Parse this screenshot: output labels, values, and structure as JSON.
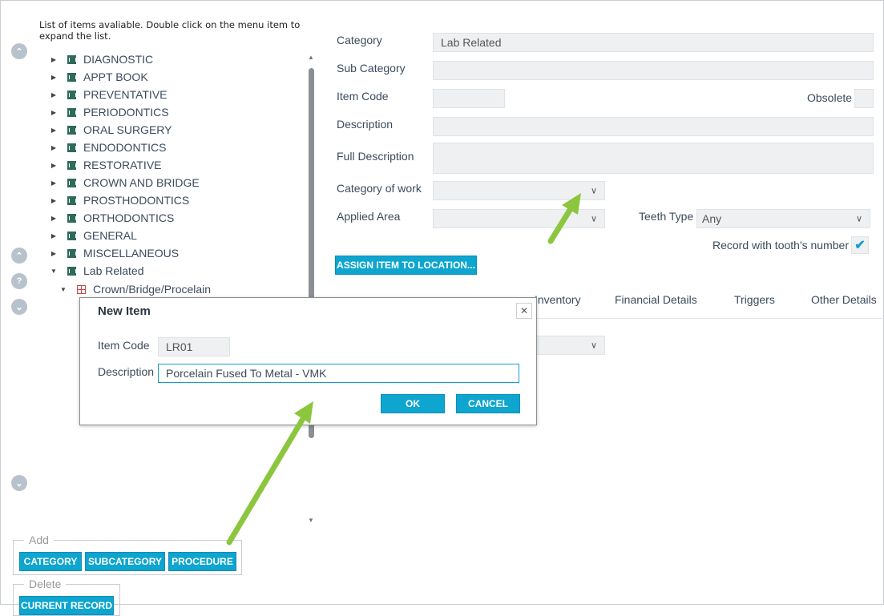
{
  "hint": "List of items avaliable. Double click on the menu item to expand the list.",
  "tree": {
    "categories": [
      "DIAGNOSTIC",
      "APPT BOOK",
      "PREVENTATIVE",
      "PERIODONTICS",
      "ORAL SURGERY",
      "ENDODONTICS",
      "RESTORATIVE",
      "CROWN AND BRIDGE",
      "PROSTHODONTICS",
      "ORTHODONTICS",
      "GENERAL",
      "MISCELLANEOUS",
      "Lab Related"
    ],
    "subcategory": "Crown/Bridge/Procelain"
  },
  "form": {
    "category_label": "Category",
    "category_value": "Lab Related",
    "subcategory_label": "Sub Category",
    "item_code_label": "Item Code",
    "obsolete_label": "Obsolete",
    "description_label": "Description",
    "full_description_label": "Full Description",
    "category_of_work_label": "Category of work",
    "applied_area_label": "Applied Area",
    "teeth_type_label": "Teeth Type",
    "teeth_type_value": "Any",
    "record_teeth_label": "Record with tooth's number",
    "assign_button": "ASSIGN ITEM TO LOCATION..."
  },
  "tabs": [
    "Inventory",
    "Financial Details",
    "Triggers",
    "Other Details"
  ],
  "modal": {
    "title": "New Item",
    "item_code_label": "Item Code",
    "item_code_value": "LR01",
    "description_label": "Description",
    "description_value": "Porcelain Fused To Metal - VMK",
    "ok": "OK",
    "cancel": "CANCEL",
    "close": "✕"
  },
  "add_group": {
    "title": "Add",
    "buttons": [
      "CATEGORY",
      "SUBCATEGORY",
      "PROCEDURE"
    ]
  },
  "delete_group": {
    "title": "Delete",
    "button": "CURRENT RECORD"
  },
  "colors": {
    "accent": "#0ea5cf",
    "annotation_arrow": "#8cc63f"
  }
}
